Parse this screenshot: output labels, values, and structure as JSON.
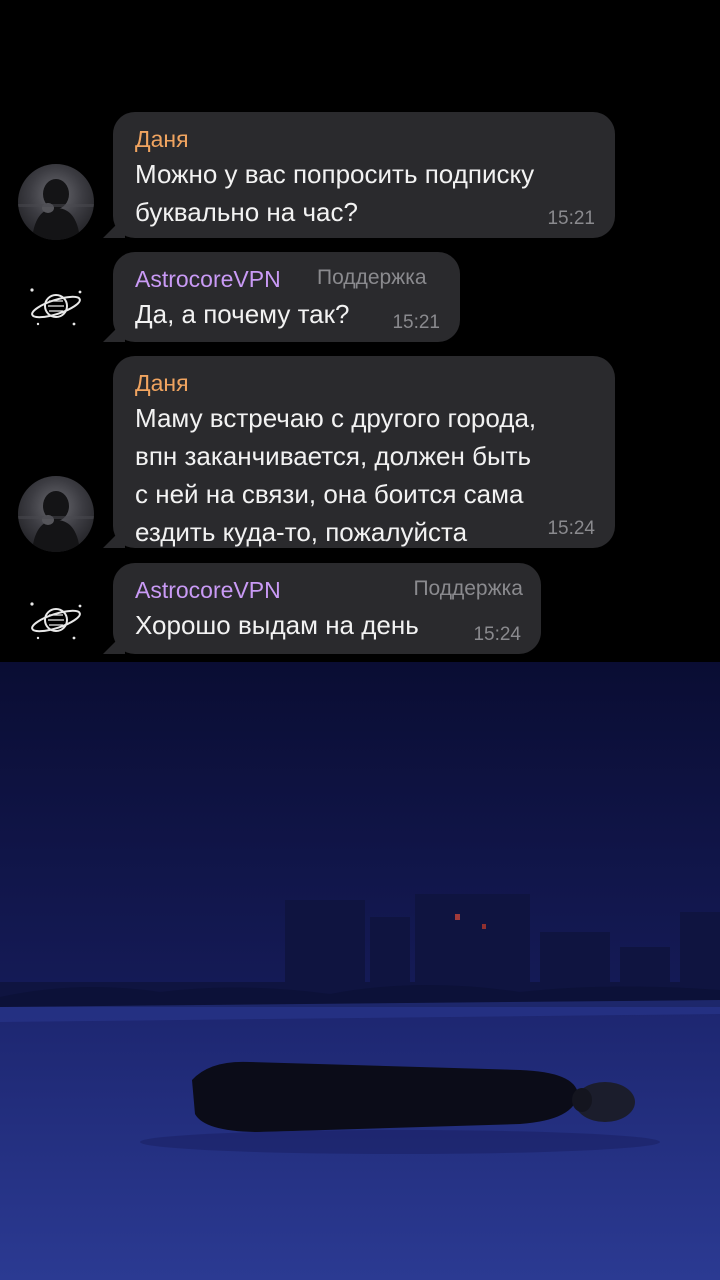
{
  "messages": [
    {
      "sender": "Даня",
      "lines": [
        "Можно у вас попросить подписку",
        "буквально на час?"
      ],
      "time": "15:21"
    },
    {
      "sender": "AstrocoreVPN",
      "role": "Поддержка",
      "lines": [
        "Да, а почему так?"
      ],
      "time": "15:21"
    },
    {
      "sender": "Даня",
      "lines": [
        "Маму встречаю с другого города,",
        "впн заканчивается, должен быть",
        "с ней на связи, она боится сама",
        "ездить куда-то, пожалуйста"
      ],
      "time": "15:24"
    },
    {
      "sender": "AstrocoreVPN",
      "role": "Поддержка",
      "lines": [
        "Хорошо выдам на день"
      ],
      "time": "15:24"
    }
  ],
  "icons": {
    "user_avatar": "user-avatar-photo",
    "bot_avatar": "saturn-planet-icon"
  },
  "colors": {
    "chat_bg": "#000000",
    "bubble_bg": "#2a2a2d",
    "user_name": "#f0a460",
    "bot_name": "#c99af5",
    "text": "#f2f2f2",
    "meta": "#8a8a8e",
    "photo_sky": "#10154a",
    "photo_snow": "#22307e"
  }
}
